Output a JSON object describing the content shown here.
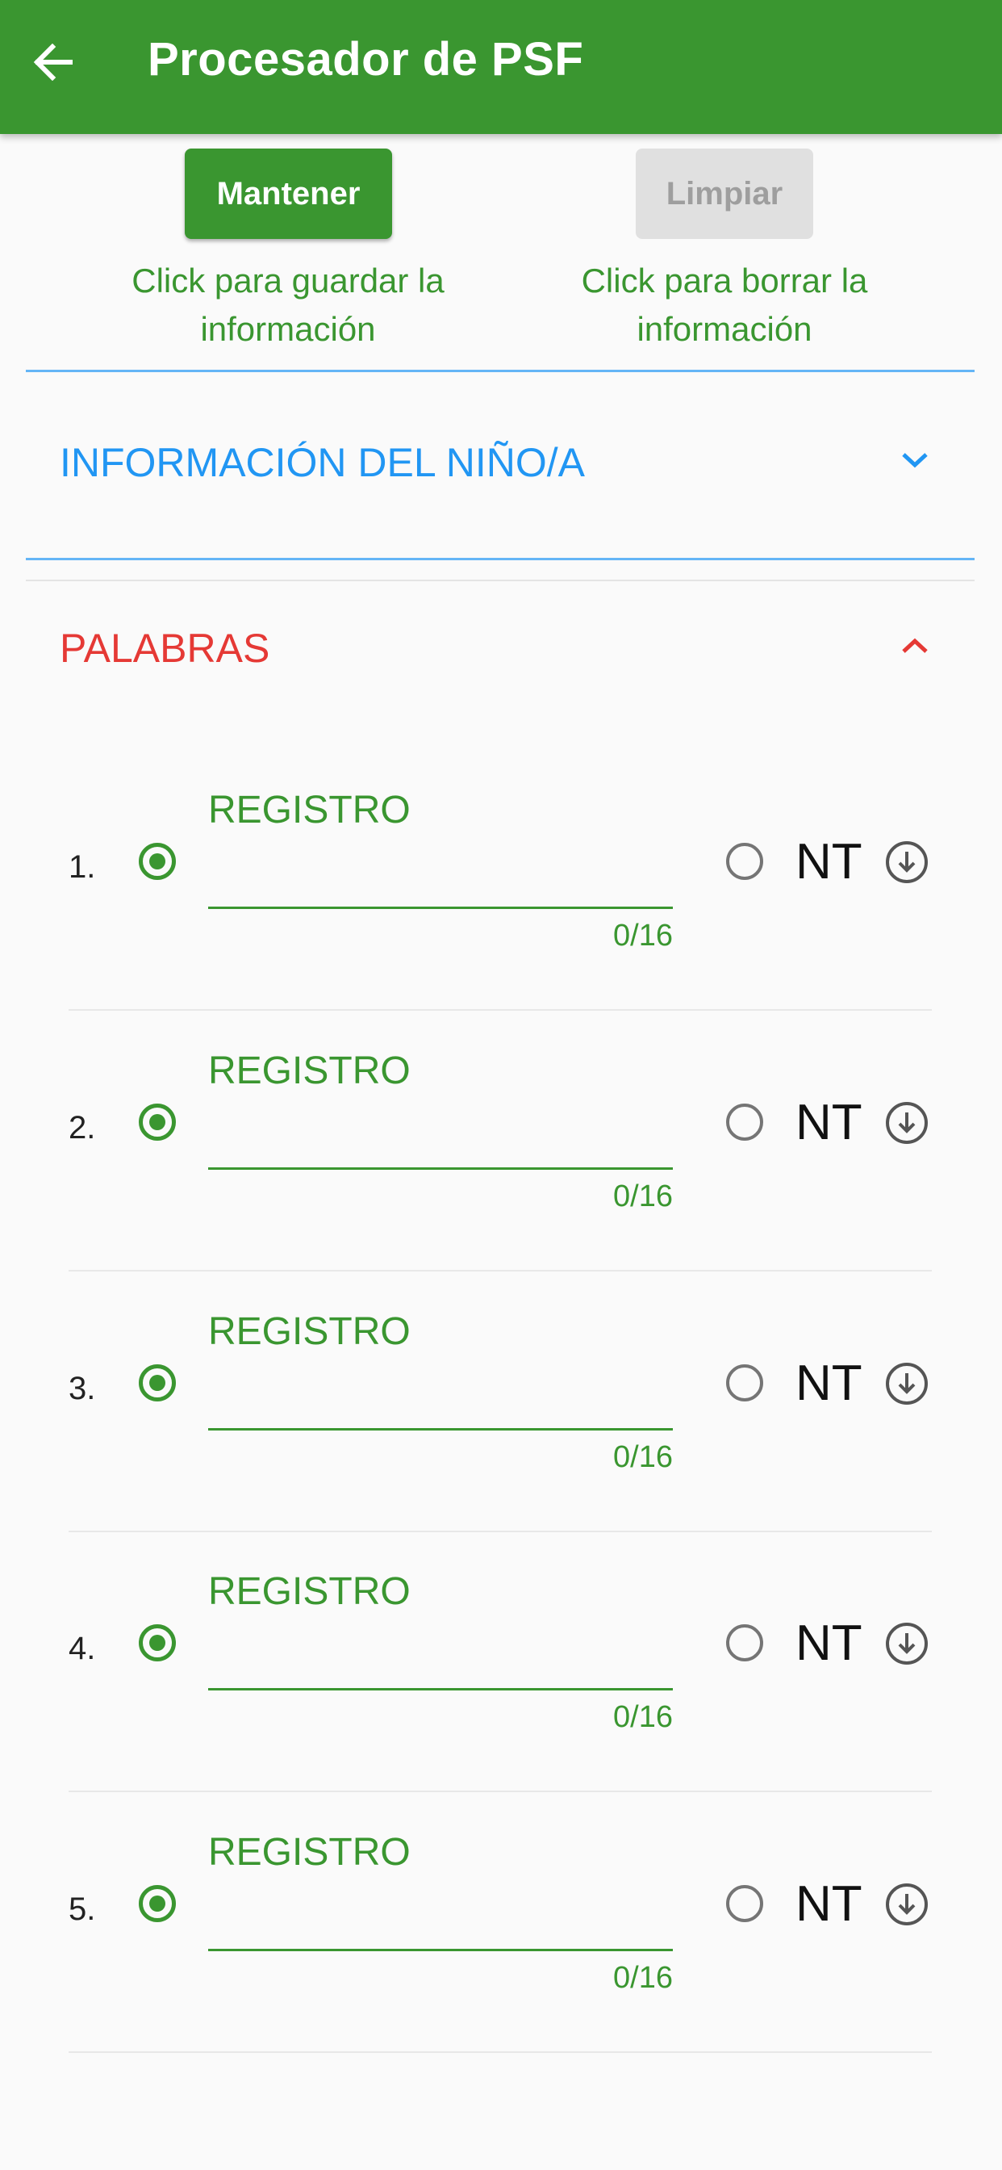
{
  "appbar": {
    "title": "Procesador de PSF",
    "back_icon": "arrow-left-icon",
    "color": "#3a9630"
  },
  "actions": {
    "save_label": "Mantener",
    "save_hint": "Click para guardar la información",
    "clear_label": "Limpiar",
    "clear_hint": "Click para borrar la información"
  },
  "sections": {
    "child_info": {
      "label": "INFORMACIÓN DEL NIÑO/A",
      "color": "#2196f3",
      "expanded": false,
      "icon": "chevron-down-icon"
    },
    "words": {
      "label": "PALABRAS",
      "color": "#e53935",
      "expanded": true,
      "icon": "chevron-up-icon"
    }
  },
  "words": [
    {
      "number": "1.",
      "field_label": "REGISTRO",
      "value": "",
      "counter": "0/16",
      "alt_label": "NT"
    },
    {
      "number": "2.",
      "field_label": "REGISTRO",
      "value": "",
      "counter": "0/16",
      "alt_label": "NT"
    },
    {
      "number": "3.",
      "field_label": "REGISTRO",
      "value": "",
      "counter": "0/16",
      "alt_label": "NT"
    },
    {
      "number": "4.",
      "field_label": "REGISTRO",
      "value": "",
      "counter": "0/16",
      "alt_label": "NT"
    },
    {
      "number": "5.",
      "field_label": "REGISTRO",
      "value": "",
      "counter": "0/16",
      "alt_label": "NT"
    }
  ]
}
